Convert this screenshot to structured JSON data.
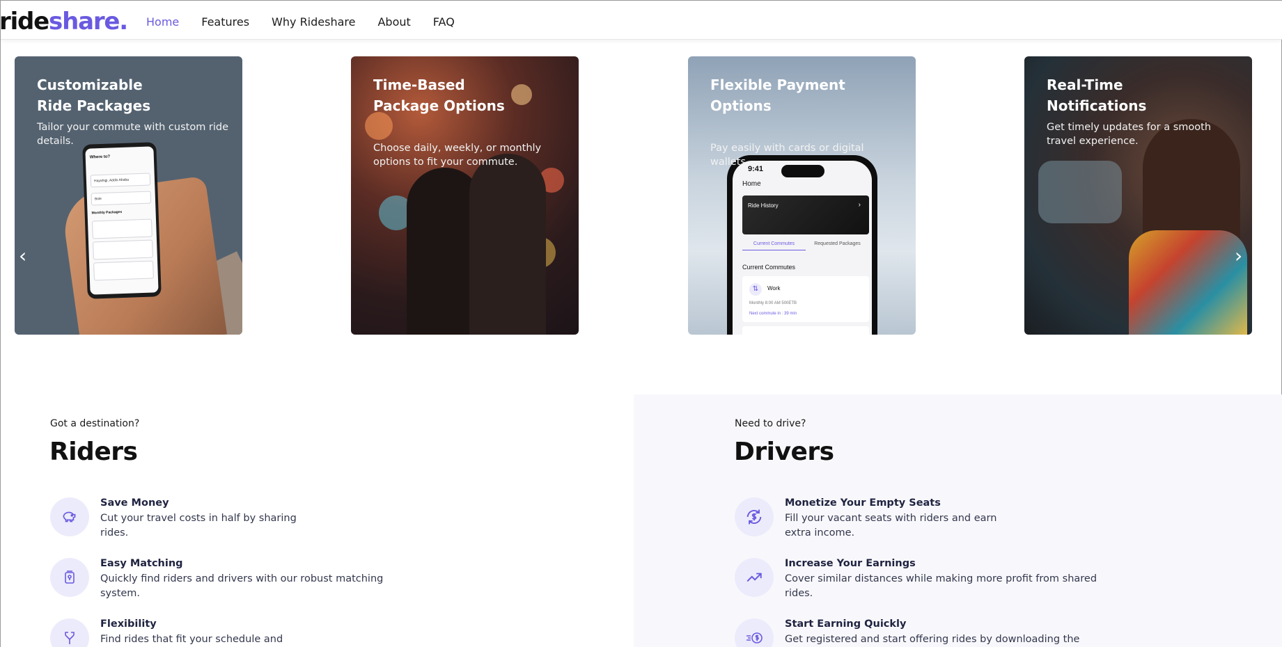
{
  "brand": {
    "part1": "ride",
    "part2": "share.",
    "accent": "#6a5ae0"
  },
  "nav": {
    "items": [
      "Home",
      "Features",
      "Why Rideshare",
      "About",
      "FAQ"
    ],
    "active": "Home"
  },
  "cards": [
    {
      "title": "Customizable Ride Packages",
      "desc": "Tailor your commute with custom ride details."
    },
    {
      "title": "Time-Based Package Options",
      "desc": "Choose daily, weekly, or monthly options to fit your commute."
    },
    {
      "title": "Flexible Payment Options",
      "desc": "Pay easily with cards or digital wallets."
    },
    {
      "title": "Real-Time Notifications",
      "desc": "Get timely updates for a smooth travel experience."
    }
  ],
  "phone_card1": {
    "heading": "Where to?",
    "rows": [
      "Hayahigi, Addis Ababa",
      "Bole"
    ],
    "packages": "Monthly Packages"
  },
  "phone_card3": {
    "time": "9:41",
    "home": "Home",
    "banner": "Ride History",
    "tabs": [
      "Current Commutes",
      "Requested Packages"
    ],
    "section": "Current Commutes",
    "item_name": "Work",
    "item_meta": "Monthly     8:00 AM     500ETB",
    "item_next": "Next commute in : 39 min"
  },
  "carousel": {
    "prev": "‹",
    "next": "›"
  },
  "riders": {
    "eyebrow": "Got a destination?",
    "title": "Riders",
    "features": [
      {
        "icon": "piggy-bank-icon",
        "title": "Save Money",
        "desc": "Cut your travel costs in half by sharing rides."
      },
      {
        "icon": "matching-icon",
        "title": "Easy Matching",
        "desc": "Quickly find riders and drivers with our robust matching system."
      },
      {
        "icon": "split-arrows-icon",
        "title": "Flexibility",
        "desc": "Find rides that fit your schedule and"
      }
    ]
  },
  "drivers": {
    "eyebrow": "Need to drive?",
    "title": "Drivers",
    "features": [
      {
        "icon": "dollar-cycle-icon",
        "title": "Monetize Your Empty Seats",
        "desc": "Fill your vacant seats with riders and earn extra income."
      },
      {
        "icon": "trend-up-icon",
        "title": "Increase Your Earnings",
        "desc": "Cover similar distances while making more profit from shared rides."
      },
      {
        "icon": "fast-money-icon",
        "title": "Start Earning Quickly",
        "desc": "Get registered and start offering rides by downloading the"
      }
    ]
  }
}
